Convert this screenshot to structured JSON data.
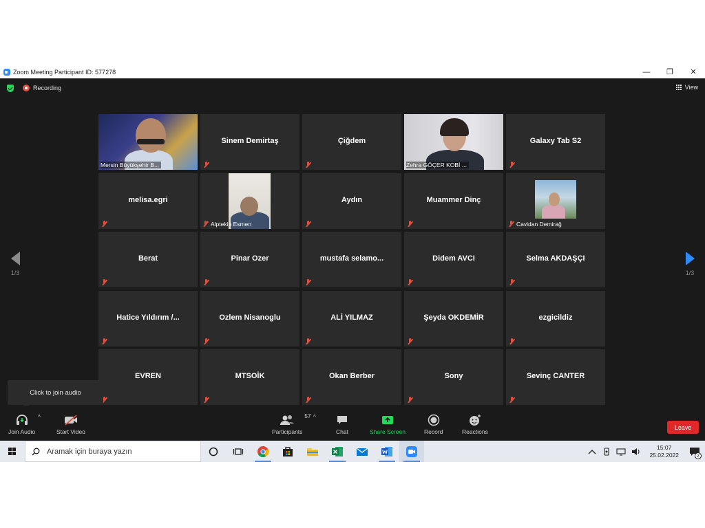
{
  "window": {
    "title": "Zoom Meeting Participant ID: 577278",
    "minimize_glyph": "—",
    "restore_glyph": "❐",
    "close_glyph": "✕"
  },
  "topbar": {
    "recording_label": "Recording",
    "view_label": "View"
  },
  "pagination": {
    "left": "1/3",
    "right": "1/3"
  },
  "tiles": [
    {
      "name": "Mersin Büyükşehir B...",
      "video": true
    },
    {
      "name": "Sinem Demirtaş",
      "video": false
    },
    {
      "name": "Çiğdem",
      "video": false
    },
    {
      "name": "Zehra GÖÇER KOBİ ...",
      "video": true,
      "active": true
    },
    {
      "name": "Galaxy Tab S2",
      "video": false
    },
    {
      "name": "melisa.egri",
      "video": false
    },
    {
      "name": "Alptekin Esmen",
      "video": true
    },
    {
      "name": "Aydın",
      "video": false
    },
    {
      "name": "Muammer Dinç",
      "video": false
    },
    {
      "name": "Cavidan Demirağ",
      "video": true
    },
    {
      "name": "Berat",
      "video": false
    },
    {
      "name": "Pinar Ozer",
      "video": false
    },
    {
      "name": "mustafa  selamo...",
      "video": false
    },
    {
      "name": "Didem AVCI",
      "video": false
    },
    {
      "name": "Selma AKDAŞÇI",
      "video": false
    },
    {
      "name": "Hatice  Yıldırım  /...",
      "video": false
    },
    {
      "name": "Ozlem Nisanoglu",
      "video": false
    },
    {
      "name": "ALİ YILMAZ",
      "video": false
    },
    {
      "name": "Şeyda OKDEMİR",
      "video": false
    },
    {
      "name": "ezgicildiz",
      "video": false
    },
    {
      "name": "EVREN",
      "video": false
    },
    {
      "name": "MTSOİK",
      "video": false
    },
    {
      "name": "Okan Berber",
      "video": false
    },
    {
      "name": "Sony",
      "video": false
    },
    {
      "name": "Sevinç CANTER",
      "video": false
    }
  ],
  "tooltip": "Click to join audio",
  "toolbar": {
    "join_audio": "Join Audio",
    "start_video": "Start Video",
    "participants": "Participants",
    "participants_count": "57",
    "chat": "Chat",
    "share_screen": "Share Screen",
    "record": "Record",
    "reactions": "Reactions",
    "leave": "Leave",
    "caret": "^"
  },
  "colors": {
    "accent_blue": "#2d8cff",
    "share_green": "#23d959",
    "leave_red": "#e02828",
    "mic_red": "#e0513f",
    "active_border": "#9ee26a"
  },
  "taskbar": {
    "search_placeholder": "Aramak için buraya yazın",
    "time": "15:07",
    "date": "25.02.2022",
    "notification_count": "2"
  }
}
